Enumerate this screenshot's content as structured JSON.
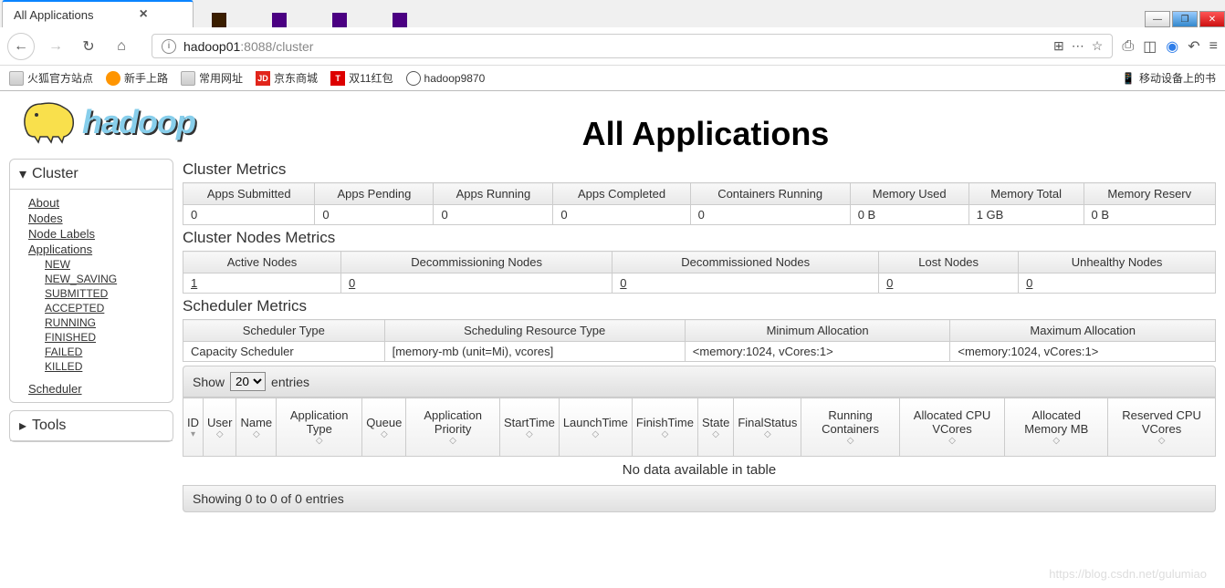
{
  "browser": {
    "tab_title": "All Applications",
    "url_prefix": "hadoop01",
    "url_port": ":8088",
    "url_path": "/cluster",
    "win_min": "—",
    "win_max": "❐",
    "win_close": "✕"
  },
  "bookmarks": {
    "b1": "火狐官方站点",
    "b2": "新手上路",
    "b3": "常用网址",
    "b4": "京东商城",
    "b5": "双11红包",
    "b6": "hadoop9870",
    "right": "移动设备上的书"
  },
  "header": {
    "logo_text": "hadoop",
    "page_title": "All Applications"
  },
  "sidebar": {
    "cluster_header": "Cluster",
    "tools_header": "Tools",
    "links": {
      "about": "About",
      "nodes": "Nodes",
      "node_labels": "Node Labels",
      "applications": "Applications",
      "new": "NEW",
      "new_saving": "NEW_SAVING",
      "submitted": "SUBMITTED",
      "accepted": "ACCEPTED",
      "running": "RUNNING",
      "finished": "FINISHED",
      "failed": "FAILED",
      "killed": "KILLED",
      "scheduler": "Scheduler"
    }
  },
  "cluster_metrics": {
    "title": "Cluster Metrics",
    "headers": {
      "h1": "Apps Submitted",
      "h2": "Apps Pending",
      "h3": "Apps Running",
      "h4": "Apps Completed",
      "h5": "Containers Running",
      "h6": "Memory Used",
      "h7": "Memory Total",
      "h8": "Memory Reserv"
    },
    "row": {
      "v1": "0",
      "v2": "0",
      "v3": "0",
      "v4": "0",
      "v5": "0",
      "v6": "0 B",
      "v7": "1 GB",
      "v8": "0 B"
    }
  },
  "nodes_metrics": {
    "title": "Cluster Nodes Metrics",
    "headers": {
      "h1": "Active Nodes",
      "h2": "Decommissioning Nodes",
      "h3": "Decommissioned Nodes",
      "h4": "Lost Nodes",
      "h5": "Unhealthy Nodes"
    },
    "row": {
      "v1": "1",
      "v2": "0",
      "v3": "0",
      "v4": "0",
      "v5": "0"
    }
  },
  "scheduler_metrics": {
    "title": "Scheduler Metrics",
    "headers": {
      "h1": "Scheduler Type",
      "h2": "Scheduling Resource Type",
      "h3": "Minimum Allocation",
      "h4": "Maximum Allocation"
    },
    "row": {
      "v1": "Capacity Scheduler",
      "v2": "[memory-mb (unit=Mi), vcores]",
      "v3": "<memory:1024, vCores:1>",
      "v4": "<memory:1024, vCores:1>"
    }
  },
  "datatable": {
    "show_label_pre": "Show",
    "show_value": "20",
    "show_label_post": "entries",
    "columns": {
      "c1": "ID",
      "c2": "User",
      "c3": "Name",
      "c4": "Application Type",
      "c5": "Queue",
      "c6": "Application Priority",
      "c7": "StartTime",
      "c8": "LaunchTime",
      "c9": "FinishTime",
      "c10": "State",
      "c11": "FinalStatus",
      "c12": "Running Containers",
      "c13": "Allocated CPU VCores",
      "c14": "Allocated Memory MB",
      "c15": "Reserved CPU VCores"
    },
    "empty": "No data available in table",
    "footer": "Showing 0 to 0 of 0 entries"
  },
  "watermark": "https://blog.csdn.net/gulumiao"
}
